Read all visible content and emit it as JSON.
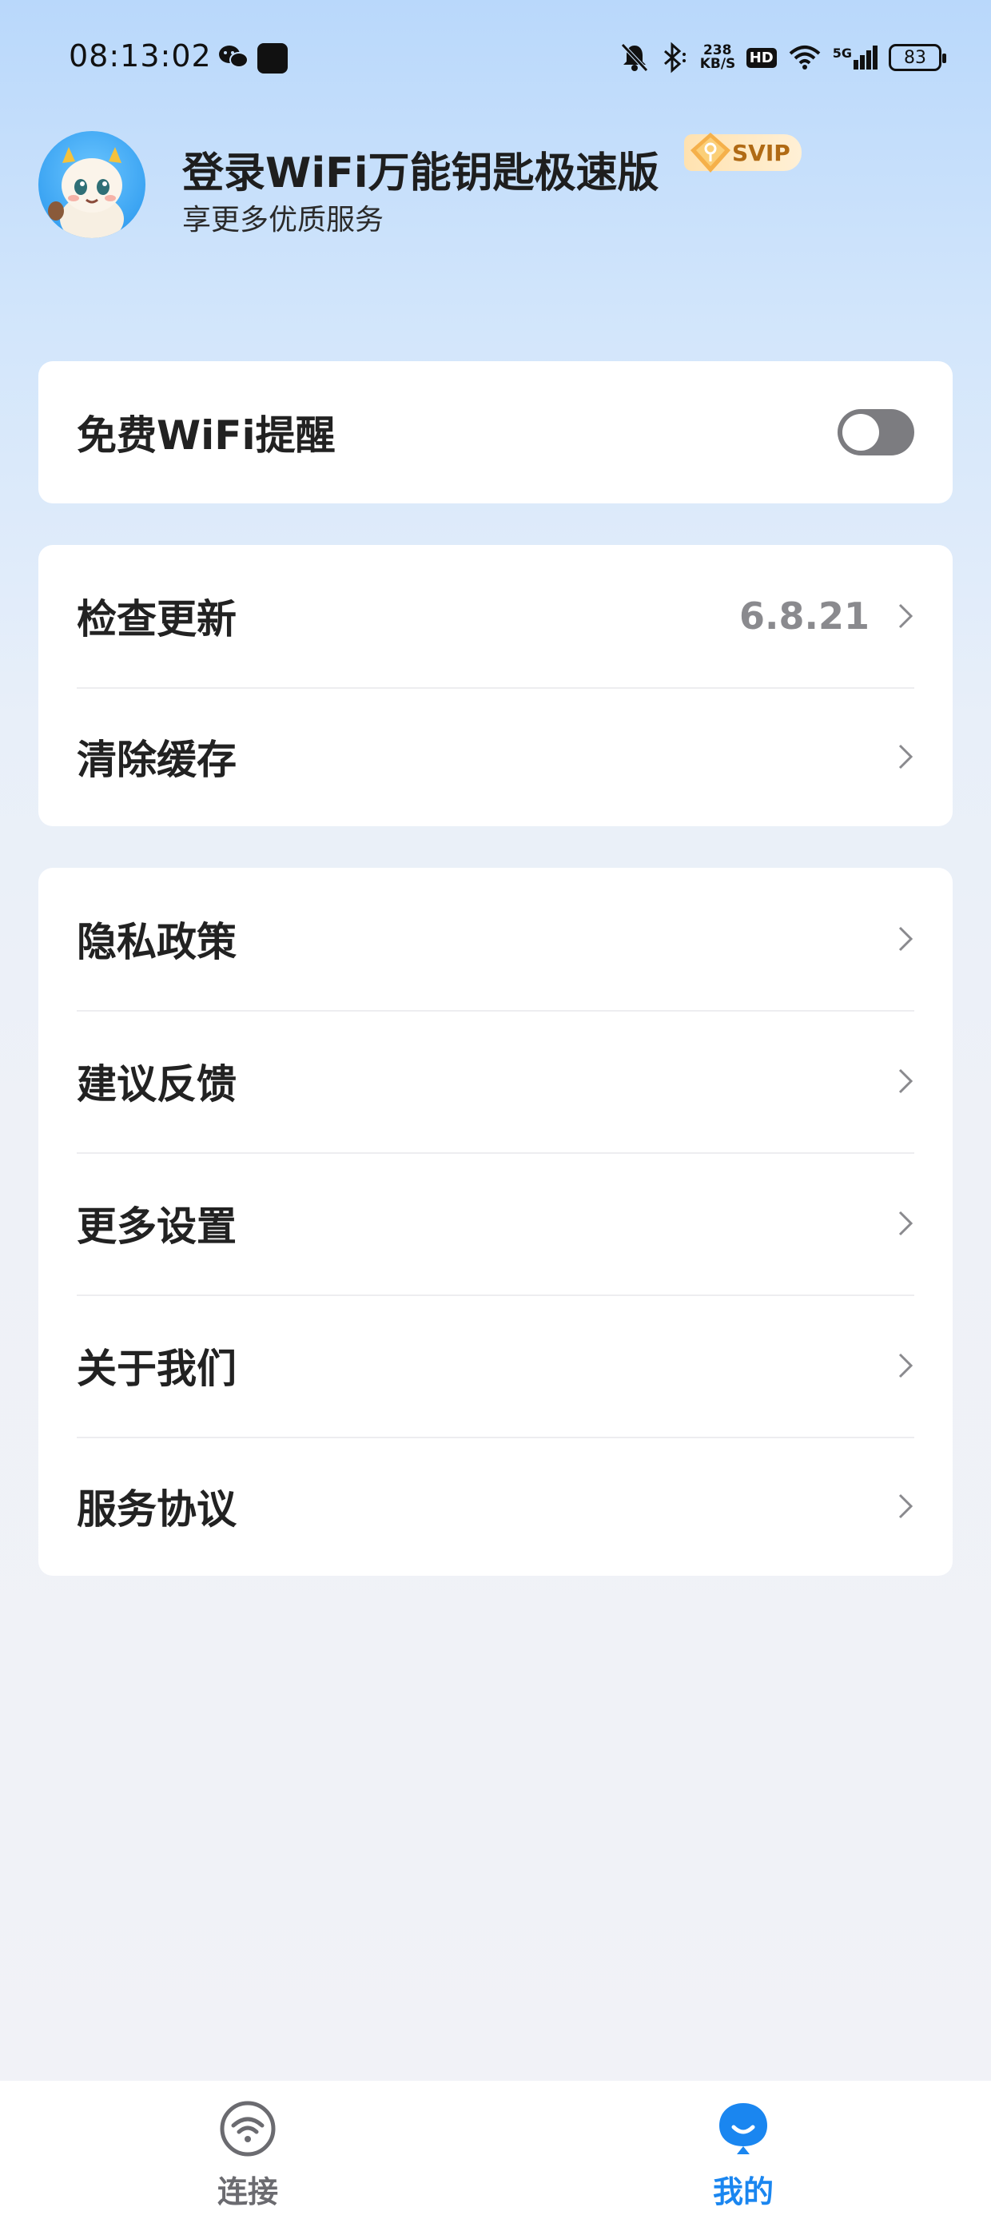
{
  "status_bar": {
    "time": "08:13:02",
    "net_speed_value": "238",
    "net_speed_unit": "KB/S",
    "hd_label": "HD",
    "network_label": "5G",
    "battery": "83",
    "icons": [
      "wechat-icon",
      "app-square-icon",
      "mute-bell-icon",
      "bluetooth-icon",
      "hd-icon",
      "wifi-icon",
      "signal-icon",
      "battery-icon"
    ]
  },
  "profile": {
    "title": "登录WiFi万能钥匙极速版",
    "subtitle": "享更多优质服务",
    "badge": "SVIP",
    "colors": {
      "badge_text": "#b06a14",
      "badge_bg": "#ffe2b0"
    }
  },
  "settings": {
    "reminder": {
      "label": "免费WiFi提醒",
      "enabled": false
    },
    "update": {
      "label": "检查更新",
      "version": "6.8.21"
    },
    "clear_cache": {
      "label": "清除缓存"
    },
    "menu": [
      {
        "label": "隐私政策"
      },
      {
        "label": "建议反馈"
      },
      {
        "label": "更多设置"
      },
      {
        "label": "关于我们"
      },
      {
        "label": "服务协议"
      }
    ]
  },
  "tabbar": {
    "tabs": [
      {
        "label": "连接",
        "icon": "wifi-icon",
        "active": false
      },
      {
        "label": "我的",
        "icon": "profile-icon",
        "active": true
      }
    ],
    "colors": {
      "active": "#1a86f0",
      "inactive": "#6b6b70"
    }
  }
}
